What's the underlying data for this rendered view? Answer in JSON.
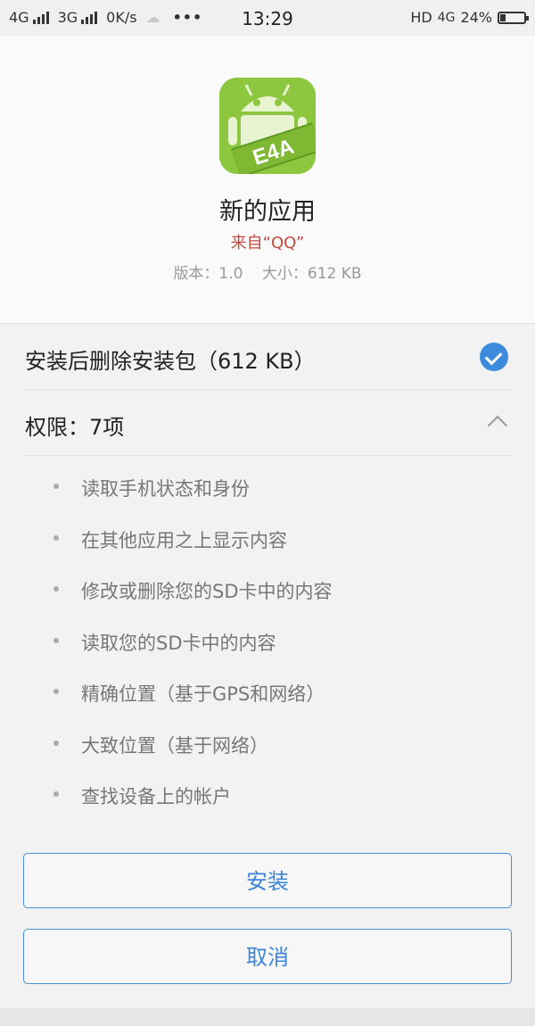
{
  "status_bar": {
    "network1": "4G",
    "network2": "3G",
    "speed": "0K/s",
    "time": "13:29",
    "hd": "HD",
    "lte": "4G",
    "battery_level": "24%",
    "battery_fraction": 0.24
  },
  "app": {
    "name": "新的应用",
    "source": "来自“QQ”",
    "version": "版本：1.0",
    "size": "大小：612 KB",
    "icon_text": "E4A",
    "icon_color": "#8dc63f"
  },
  "option": {
    "label": "安装后删除安装包（612 KB）",
    "checked": true
  },
  "permissions": {
    "label": "权限：7项",
    "items": [
      "读取手机状态和身份",
      "在其他应用之上显示内容",
      "修改或删除您的SD卡中的内容",
      "读取您的SD卡中的内容",
      "精确位置（基于GPS和网络）",
      "大致位置（基于网络）",
      "查找设备上的帐户"
    ]
  },
  "buttons": {
    "install": "安装",
    "cancel": "取消"
  },
  "colors": {
    "accent": "#3e86d8",
    "source_red": "#c44b3e"
  }
}
